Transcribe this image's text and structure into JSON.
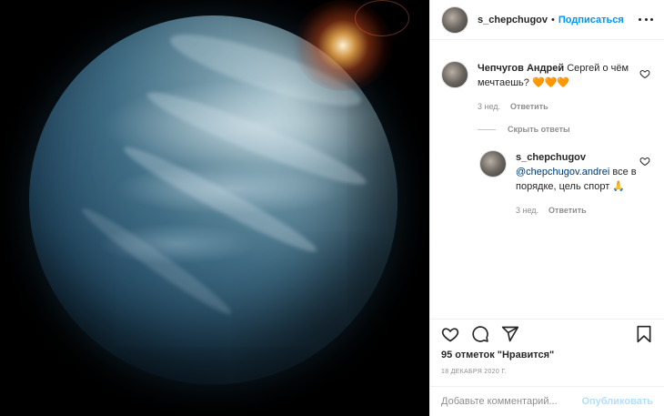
{
  "header": {
    "username": "s_chepchugov",
    "separator": "•",
    "follow_label": "Подписаться"
  },
  "comments": [
    {
      "author": "Чепчугов Андрей",
      "text": "Сергей о чём мечтаешь?",
      "emoji": "🧡🧡🧡",
      "time": "3 нед.",
      "reply_label": "Ответить"
    }
  ],
  "hide_replies_label": "Скрыть ответы",
  "reply": {
    "author": "s_chepchugov",
    "mention": "@chepchugov.andrei",
    "text": " все в порядке, цель спорт",
    "emoji": "🙏",
    "time": "3 нед.",
    "reply_label": "Ответить"
  },
  "likes": "95 отметок \"Нравится\"",
  "date": "18 ДЕКАБРЯ 2020 Г.",
  "add_comment": {
    "placeholder": "Добавьте комментарий...",
    "publish_label": "Опубликовать"
  },
  "icons": {
    "like": "heart-icon",
    "comment": "comment-icon",
    "share": "share-icon",
    "save": "bookmark-icon",
    "more": "more-icon"
  }
}
